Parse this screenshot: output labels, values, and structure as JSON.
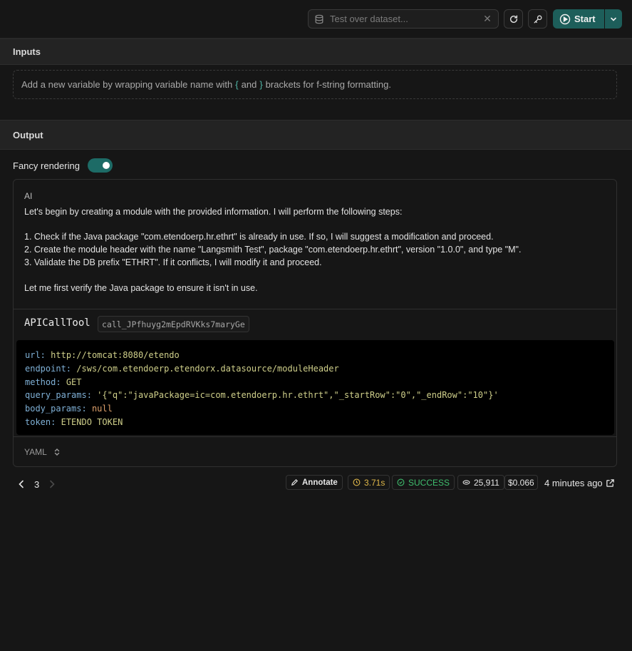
{
  "toolbar": {
    "dataset_placeholder": "Test over dataset...",
    "clear_icon": "✕",
    "start_label": "Start"
  },
  "inputs": {
    "header": "Inputs",
    "hint_before": "Add a new variable by wrapping variable name with",
    "open_brace": "{",
    "and_text": "and",
    "close_brace": "}",
    "hint_after": "brackets for f-string formatting."
  },
  "output": {
    "header": "Output",
    "fancy_label": "Fancy rendering",
    "fancy_enabled": true
  },
  "message": {
    "role": "AI",
    "lines": [
      "Let's begin by creating a module with the provided information. I will perform the following steps:",
      "1. Check if the Java package \"com.etendoerp.hr.ethrt\" is already in use. If so, I will suggest a modification and proceed.",
      "2. Create the module header with the name \"Langsmith Test\", package \"com.etendoerp.hr.ethrt\", version \"1.0.0\", and type \"M\".",
      "3. Validate the DB prefix \"ETHRT\". If it conflicts, I will modify it and proceed.",
      "Let me first verify the Java package to ensure it isn't in use."
    ]
  },
  "tool_call": {
    "name": "APICallTool",
    "id": "call_JPfhuyg2mEpdRVKks7maryGe",
    "params": [
      {
        "key": "url:",
        "value": "http://tomcat:8080/etendo"
      },
      {
        "key": "endpoint:",
        "value": "/sws/com.etendoerp.etendorx.datasource/moduleHeader"
      },
      {
        "key": "method:",
        "value": "GET"
      },
      {
        "key": "query_params:",
        "value": "'{\"q\":\"javaPackage=ic=com.etendoerp.hr.ethrt\",\"_startRow\":\"0\",\"_endRow\":\"10\"}'"
      },
      {
        "key": "body_params:",
        "value": "null"
      },
      {
        "key": "token:",
        "value": "ETENDO TOKEN"
      }
    ],
    "format": "YAML"
  },
  "footer": {
    "page": "3",
    "annotate_label": "Annotate",
    "latency": "3.71s",
    "status": "SUCCESS",
    "tokens": "25,911",
    "cost": "$0.066",
    "time_ago": "4 minutes ago"
  },
  "colors": {
    "accent": "#1d5e5a",
    "latency": "#e0b84a",
    "success": "#3fbf6e"
  }
}
